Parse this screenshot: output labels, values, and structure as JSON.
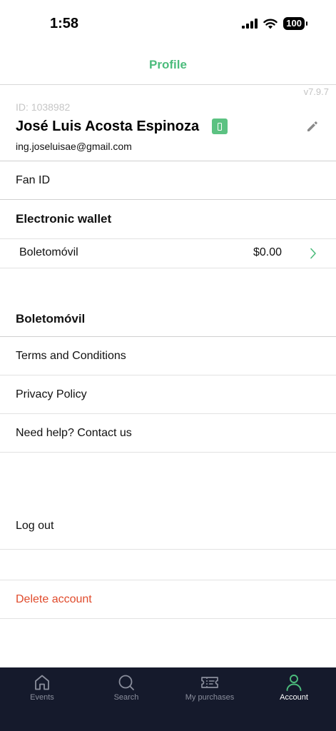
{
  "status_bar": {
    "time": "1:58",
    "battery": "100"
  },
  "header": {
    "title": "Profile"
  },
  "profile": {
    "version": "v7.9.7",
    "id": "ID: 1038982",
    "name": "José Luis Acosta Espinoza",
    "email": "ing.joseluisae@gmail.com",
    "badge_icon": "phone-icon",
    "edit_icon": "pencil-icon"
  },
  "menu": {
    "fan_id": "Fan ID",
    "wallet_section": "Electronic wallet",
    "wallet": {
      "name": "Boletomóvil",
      "amount": "$0.00"
    },
    "app_section": "Boletomóvil",
    "terms": "Terms and Conditions",
    "privacy": "Privacy Policy",
    "help": "Need help? Contact us",
    "logout": "Log out",
    "delete": "Delete account"
  },
  "tabs": [
    {
      "label": "Events",
      "icon": "home-icon",
      "active": false
    },
    {
      "label": "Search",
      "icon": "search-icon",
      "active": false
    },
    {
      "label": "My purchases",
      "icon": "ticket-icon",
      "active": false
    },
    {
      "label": "Account",
      "icon": "person-icon",
      "active": true
    }
  ],
  "colors": {
    "accent": "#4cbc7c",
    "danger": "#e04b2c",
    "tab_bar": "#151a2c"
  }
}
